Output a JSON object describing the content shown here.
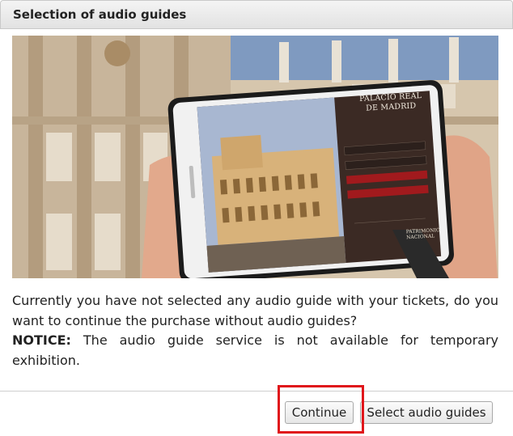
{
  "dialog": {
    "title": "Selection of audio guides",
    "message": "Currently you have not selected any audio guide with your tickets, do you want to continue the purchase without audio guides?",
    "notice_label": "NOTICE:",
    "notice_text": "The audio guide service is not available for temporary exhibition."
  },
  "promo": {
    "tablet_heading": "PALACIO REAL DE MADRID",
    "tablet_footer": "PATRIMONIO NACIONAL"
  },
  "buttons": {
    "continue": "Continue",
    "select_audio_guides": "Select audio guides"
  },
  "colors": {
    "highlight_border": "#e0161b",
    "title_bar": "#e8e8e8"
  }
}
